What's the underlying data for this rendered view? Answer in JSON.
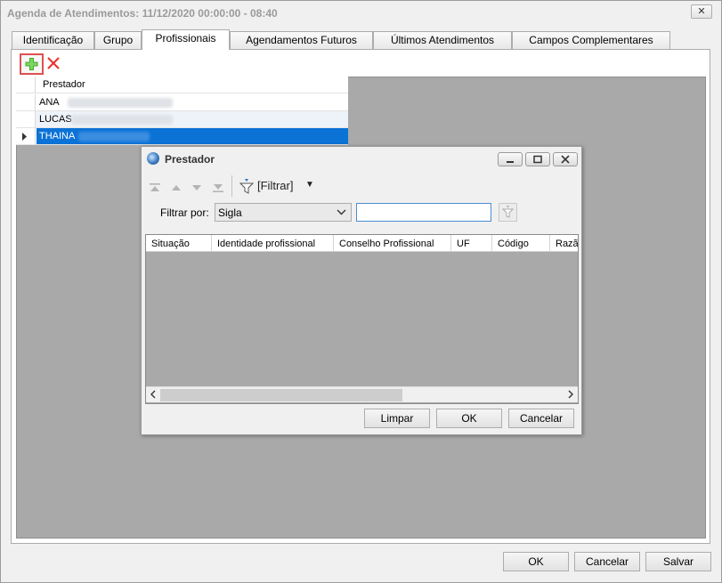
{
  "window": {
    "title": "Agenda de Atendimentos: 11/12/2020 00:00:00 - 08:40",
    "close_glyph": "✕"
  },
  "tabs": [
    {
      "label": "Identificação"
    },
    {
      "label": "Grupo"
    },
    {
      "label": "Profissionais"
    },
    {
      "label": "Agendamentos Futuros"
    },
    {
      "label": "Últimos Atendimentos"
    },
    {
      "label": "Campos Complementares"
    }
  ],
  "active_tab": "Profissionais",
  "toolbar": {
    "add_icon": "plus-icon",
    "delete_icon": "x-icon"
  },
  "grid": {
    "column_header": "Prestador",
    "rows": [
      {
        "name": "ANA"
      },
      {
        "name": "LUCAS"
      },
      {
        "name": "THAINA"
      }
    ],
    "selected_row": "THAINA"
  },
  "dialog": {
    "title": "Prestador",
    "filtrar_label": "[Filtrar]",
    "filter_by_label": "Filtrar por:",
    "filter_select_value": "Sigla",
    "filter_input_value": "",
    "columns": [
      {
        "label": "Situação"
      },
      {
        "label": "Identidade profissional"
      },
      {
        "label": "Conselho Profissional"
      },
      {
        "label": "UF"
      },
      {
        "label": "Código"
      },
      {
        "label": "Razã"
      }
    ],
    "buttons": {
      "clear": "Limpar",
      "ok": "OK",
      "cancel": "Cancelar"
    }
  },
  "footer": {
    "ok": "OK",
    "cancel": "Cancelar",
    "save": "Salvar"
  }
}
